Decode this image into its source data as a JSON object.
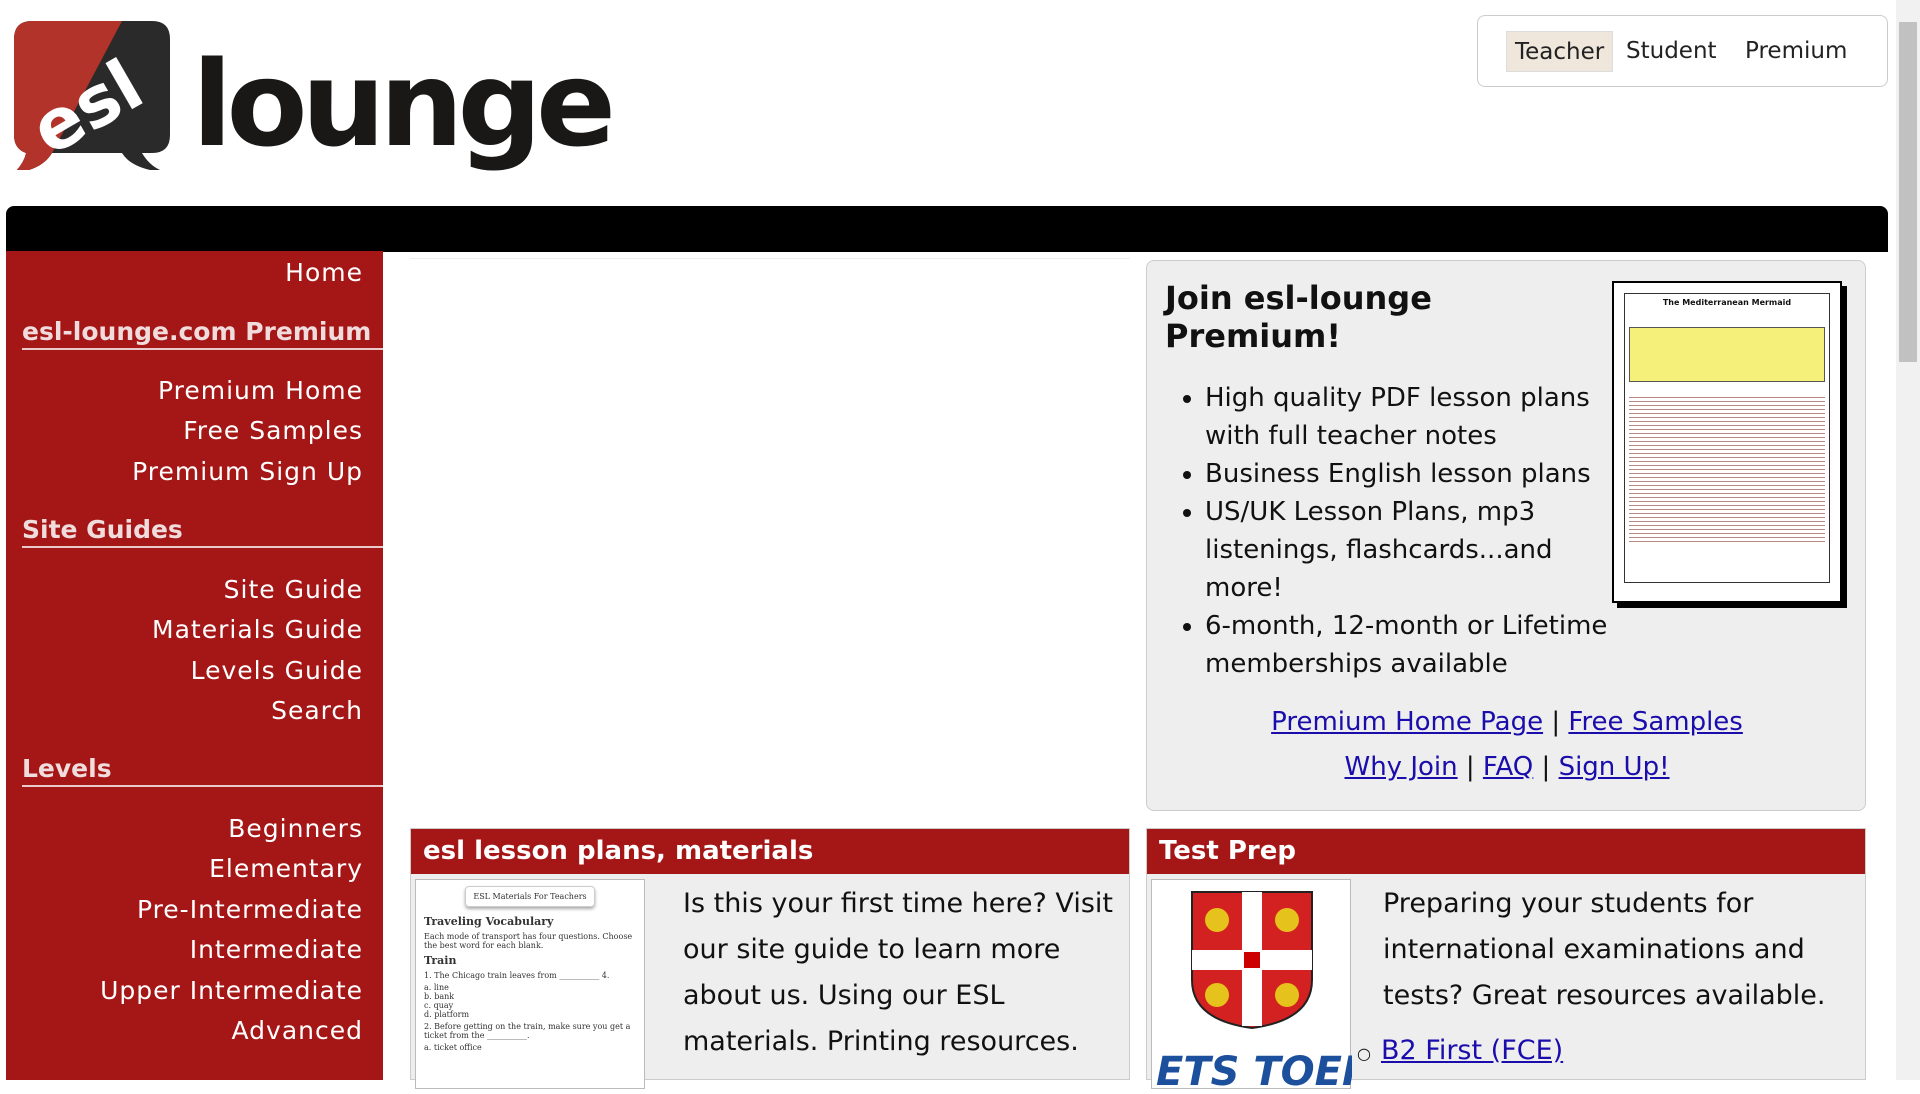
{
  "logo": {
    "text": "esl lounge"
  },
  "topnav": [
    "Teacher",
    "Student",
    "Premium"
  ],
  "sidebar": {
    "home": "Home",
    "premium_heading": "esl-lounge.com Premium",
    "premium_items": [
      "Premium Home",
      "Free Samples",
      "Premium Sign Up"
    ],
    "guides_heading": "Site Guides",
    "guides_items": [
      "Site Guide",
      "Materials Guide",
      "Levels Guide",
      "Search"
    ],
    "levels_heading": "Levels",
    "levels_items": [
      "Beginners",
      "Elementary",
      "Pre-Intermediate",
      "Intermediate",
      "Upper Intermediate",
      "Advanced"
    ]
  },
  "premium": {
    "title": "Join esl-lounge Premium!",
    "bullets": [
      "High quality PDF lesson plans with full teacher notes",
      "Business English lesson plans",
      "US/UK Lesson Plans, mp3 listenings, flashcards...and more!",
      "6-month, 12-month or Lifetime memberships available"
    ],
    "links": [
      "Premium Home Page",
      "Free Samples",
      "Why Join",
      "FAQ",
      "Sign Up!"
    ],
    "sep": "|",
    "image_title": "The Mediterranean Mermaid"
  },
  "lesson": {
    "title": "esl lesson plans, materials",
    "text": "Is this your first time here? Visit our site guide to learn more about us. Using our ESL materials. Printing resources.",
    "worksheet": {
      "header": "ESL Materials For Teachers",
      "title": "Traveling Vocabulary",
      "instructions": "Each mode of transport has four questions. Choose the best word for each blank.",
      "section": "Train",
      "q1": "1. The Chicago train leaves from __________ 4.",
      "options": [
        "a. line",
        "b. bank",
        "c. quay",
        "d. platform"
      ],
      "q2": "2. Before getting on the train, make sure you get a ticket from the __________.",
      "q2a": "a. ticket office"
    }
  },
  "testprep": {
    "title": "Test Prep",
    "text": "Preparing your students for international examinations and tests? Great resources available.",
    "links": [
      "B2 First (FCE)"
    ],
    "logo_text": "ETS TOEFL"
  }
}
